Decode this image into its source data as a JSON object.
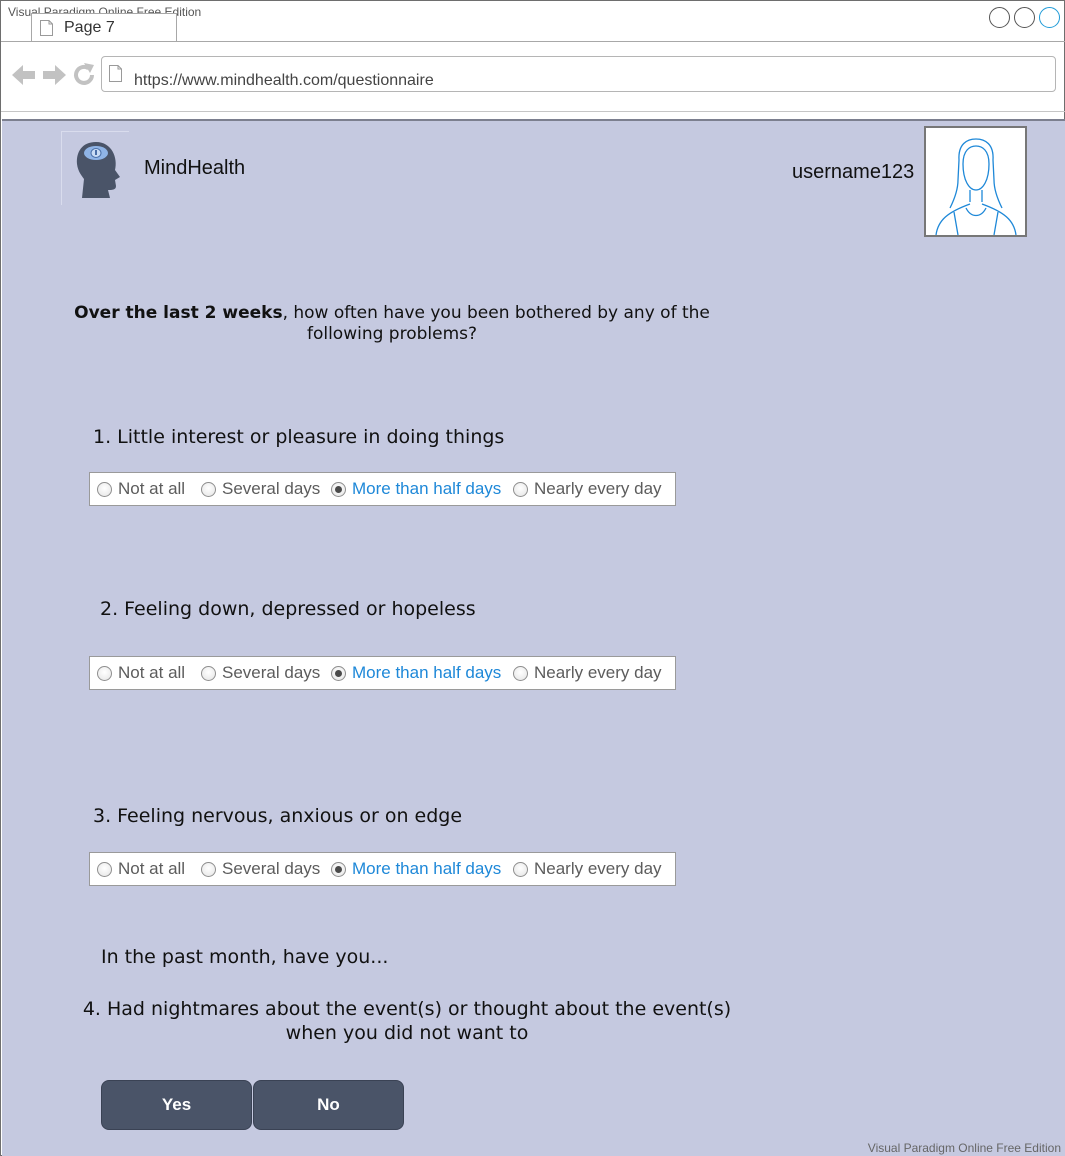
{
  "watermark": "Visual Paradigm Online Free Edition",
  "browser": {
    "tab_label": "Page 7",
    "url": "https://www.mindhealth.com/questionnaire"
  },
  "header": {
    "brand": "MindHealth",
    "username": "username123"
  },
  "intro": {
    "bold": "Over the last 2 weeks",
    "rest": ", how often have you been bothered by any of the following problems?"
  },
  "options": [
    "Not at all",
    "Several days",
    "More than half days",
    "Nearly every day"
  ],
  "questions": [
    {
      "label": "1. Little interest or pleasure in doing things",
      "selected": "More than half days"
    },
    {
      "label": "2. Feeling down, depressed or hopeless",
      "selected": "More than half days"
    },
    {
      "label": "3. Feeling nervous, anxious or on edge",
      "selected": "More than half days"
    }
  ],
  "past_month": "In the past month, have you...",
  "question4": "4. Had nightmares about the event(s) or thought about the event(s) when you did not want to",
  "buttons": {
    "yes": "Yes",
    "no": "No"
  },
  "colors": {
    "content_bg": "#c5c9e0",
    "button_bg": "#4a5468",
    "selected_text": "#1e88d8",
    "window_accent": "#1f9bd8"
  }
}
